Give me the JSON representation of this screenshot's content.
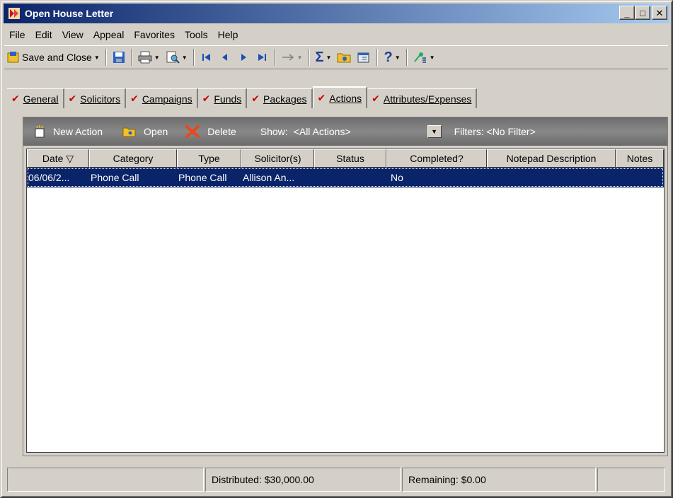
{
  "window": {
    "title": "Open House Letter"
  },
  "title_buttons": {
    "minimize": "_",
    "maximize": "□",
    "close": "✕"
  },
  "menu": [
    "File",
    "Edit",
    "View",
    "Appeal",
    "Favorites",
    "Tools",
    "Help"
  ],
  "toolbar": {
    "save_close_label": "Save and Close",
    "sigma": "Σ",
    "help": "?"
  },
  "tabs": [
    {
      "label": "General"
    },
    {
      "label": "Solicitors"
    },
    {
      "label": "Campaigns"
    },
    {
      "label": "Funds"
    },
    {
      "label": "Packages"
    },
    {
      "label": "Actions",
      "active": true
    },
    {
      "label": "Attributes/Expenses"
    }
  ],
  "actions_toolbar": {
    "new_action": "New Action",
    "open": "Open",
    "delete": "Delete",
    "show_label": "Show:",
    "show_value": "<All Actions>",
    "filters_label": "Filters: <No Filter>"
  },
  "grid": {
    "columns": [
      "Date ▽",
      "Category",
      "Type",
      "Solicitor(s)",
      "Status",
      "Completed?",
      "Notepad Description",
      "Notes"
    ],
    "rows": [
      [
        "06/06/2...",
        "Phone Call",
        "Phone Call",
        "Allison An...",
        "",
        "No",
        "",
        ""
      ]
    ]
  },
  "status": {
    "distributed": "Distributed: $30,000.00",
    "remaining": "Remaining: $0.00"
  },
  "colors": {
    "title_start": "#0a246a",
    "title_end": "#a6caf0",
    "selection": "#0a246a",
    "check": "#cc0000"
  }
}
